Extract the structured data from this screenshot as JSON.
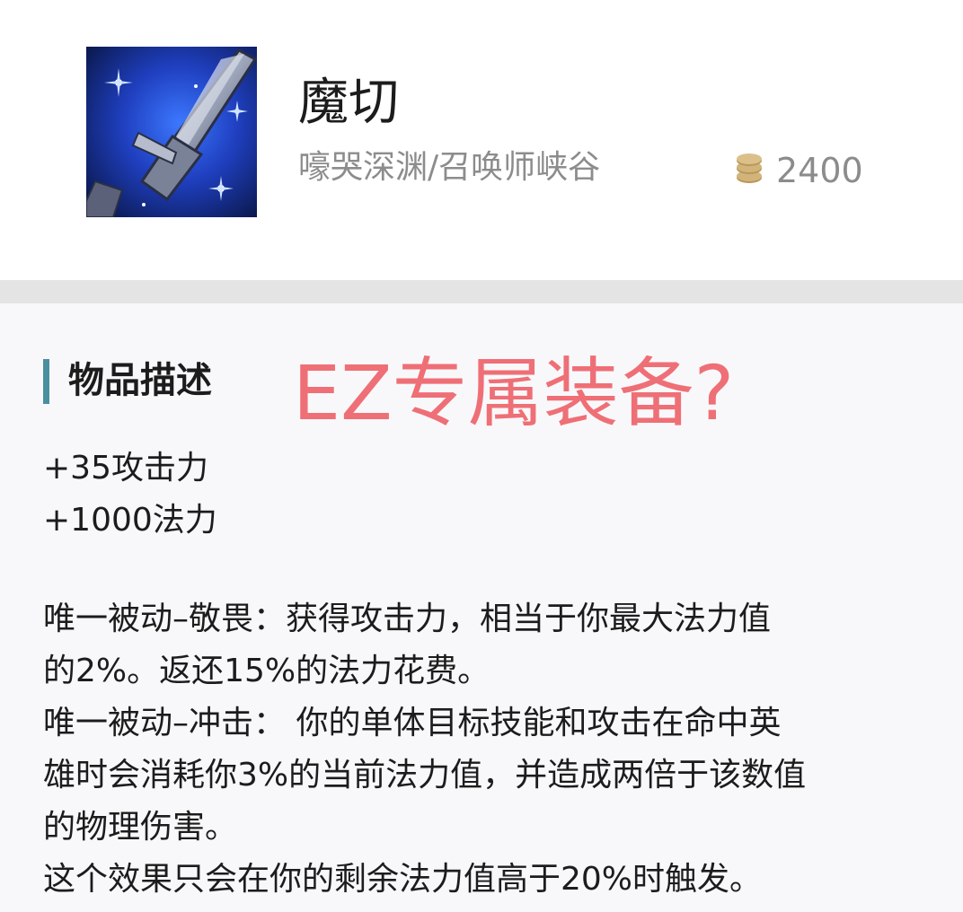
{
  "item": {
    "name": "魔切",
    "maps": "嚎哭深渊/召唤师峡谷",
    "price": "2400",
    "icon": "muramana-sword-icon",
    "gold_icon": "gold-coins-icon",
    "colors": {
      "accent_bar": "#4a8fa0",
      "overlay_text": "#ef6f76",
      "gold": "#c7a86a"
    }
  },
  "section": {
    "title": "物品描述"
  },
  "overlay": {
    "caption": "EZ专属装备?"
  },
  "stats": [
    "+35攻击力",
    "+1000法力"
  ],
  "description": {
    "lines": [
      "唯一被动–敬畏：获得攻击力，相当于你最大法力值",
      "的2%。返还15%的法力花费。",
      "唯一被动–冲击： 你的单体目标技能和攻击在命中英",
      "雄时会消耗你3%的当前法力值，并造成两倍于该数值",
      "的物理伤害。",
      "这个效果只会在你的剩余法力值高于20%时触发。"
    ]
  }
}
